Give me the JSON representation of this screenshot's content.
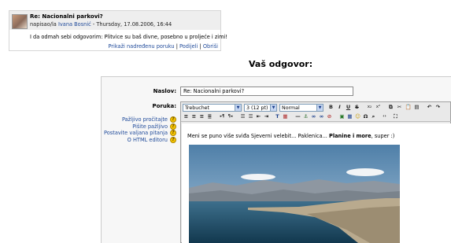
{
  "post": {
    "subject": "Re: Nacionalni parkovi?",
    "author_prefix": "napisao/la",
    "author": "Ivana Bosnić",
    "date": " - Thursday, 17.08.2006, 16:44",
    "message": "I da odmah sebi odgovorim: Plitvice su baš divne, posebno u proljeće i zimi!",
    "links": [
      "Prikaži nadređenu poruku",
      "Podijeli",
      "Obriši"
    ]
  },
  "form": {
    "title": "Vaš odgovor:",
    "subject_label": "Naslov:",
    "subject_value": "Re: Nacionalni parkovi?",
    "message_label": "Poruka:",
    "help_links": [
      "Pažljivo pročitajte",
      "Pišite pažljivo",
      "Postavite valjana pitanja",
      "O HTML editoru"
    ],
    "help_icon": "?"
  },
  "editor": {
    "font": "Trebuchet",
    "size": "3 (12 pt)",
    "format": "Normal",
    "text_plain": "Meni se puno više sviđa Sjeverni velebit... Paklenica... ",
    "text_bold": "Planine i more",
    "text_end": ", super :)",
    "format_buttons": [
      "B",
      "I",
      "U",
      "S",
      "x₂",
      "x²"
    ],
    "icons": [
      "copy-icon",
      "cut-icon",
      "paste-icon",
      "paste-word-icon",
      "undo-icon",
      "redo-icon"
    ],
    "toolbar2_icons": [
      "align-left-icon",
      "align-center-icon",
      "align-right-icon",
      "justify-icon",
      "ltr-icon",
      "rtl-icon",
      "ordered-list-icon",
      "unordered-list-icon",
      "outdent-icon",
      "indent-icon",
      "text-color-icon",
      "bg-color-icon",
      "hr-icon",
      "anchor-icon",
      "link-icon",
      "unlink-icon",
      "nolink-icon",
      "image-icon",
      "table-icon",
      "smiley-icon",
      "special-char-icon",
      "search-icon",
      "html-source-icon",
      "fullscreen-icon"
    ]
  },
  "colors": {
    "link": "#1f4a9a",
    "help_icon": "#f5c400"
  }
}
